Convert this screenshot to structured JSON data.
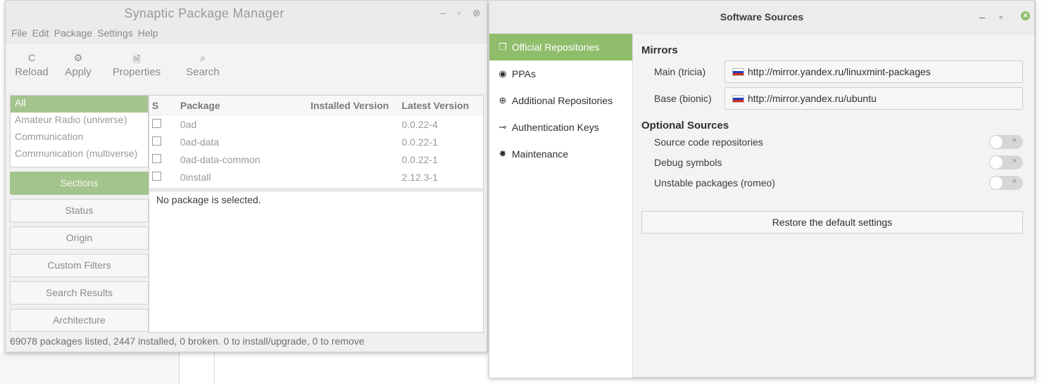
{
  "synaptic": {
    "title": "Synaptic Package Manager",
    "menu": [
      "File",
      "Edit",
      "Package",
      "Settings",
      "Help"
    ],
    "toolbar": [
      {
        "icon": "reload-icon",
        "glyph": "C",
        "label": "Reload"
      },
      {
        "icon": "apply-icon",
        "glyph": "⚙",
        "label": "Apply"
      },
      {
        "icon": "properties-icon",
        "glyph": "🗎",
        "label": "Properties"
      },
      {
        "icon": "search-icon",
        "glyph": "⌕",
        "label": "Search"
      }
    ],
    "sections": [
      "All",
      "Amateur Radio (universe)",
      "Communication",
      "Communication (multiverse)"
    ],
    "filters": [
      "Sections",
      "Status",
      "Origin",
      "Custom Filters",
      "Search Results",
      "Architecture"
    ],
    "columns": {
      "s": "S",
      "package": "Package",
      "installed": "Installed Version",
      "latest": "Latest Version"
    },
    "packages": [
      {
        "name": "0ad",
        "installed": "",
        "latest": "0.0.22-4"
      },
      {
        "name": "0ad-data",
        "installed": "",
        "latest": "0.0.22-1"
      },
      {
        "name": "0ad-data-common",
        "installed": "",
        "latest": "0.0.22-1"
      },
      {
        "name": "0install",
        "installed": "",
        "latest": "2.12.3-1"
      }
    ],
    "detail": "No package is selected.",
    "status": "69078 packages listed, 2447 installed, 0 broken. 0 to install/upgrade, 0 to remove"
  },
  "sources": {
    "title": "Software Sources",
    "sidebar": [
      {
        "icon": "package-icon",
        "glyph": "❒",
        "label": "Official Repositories"
      },
      {
        "icon": "ppa-icon",
        "glyph": "◉",
        "label": "PPAs"
      },
      {
        "icon": "globe-icon",
        "glyph": "⊕",
        "label": "Additional Repositories"
      },
      {
        "icon": "key-icon",
        "glyph": "⊸",
        "label": "Authentication Keys"
      },
      {
        "icon": "maintenance-icon",
        "glyph": "✸",
        "label": "Maintenance"
      }
    ],
    "mirrors_heading": "Mirrors",
    "mirrors": [
      {
        "label": "Main (tricia)",
        "url": "http://mirror.yandex.ru/linuxmint-packages"
      },
      {
        "label": "Base (bionic)",
        "url": "http://mirror.yandex.ru/ubuntu"
      }
    ],
    "optional_heading": "Optional Sources",
    "optional": [
      {
        "label": "Source code repositories",
        "enabled": false
      },
      {
        "label": "Debug symbols",
        "enabled": false
      },
      {
        "label": "Unstable packages (romeo)",
        "enabled": false
      }
    ],
    "restore_label": "Restore the default settings"
  }
}
